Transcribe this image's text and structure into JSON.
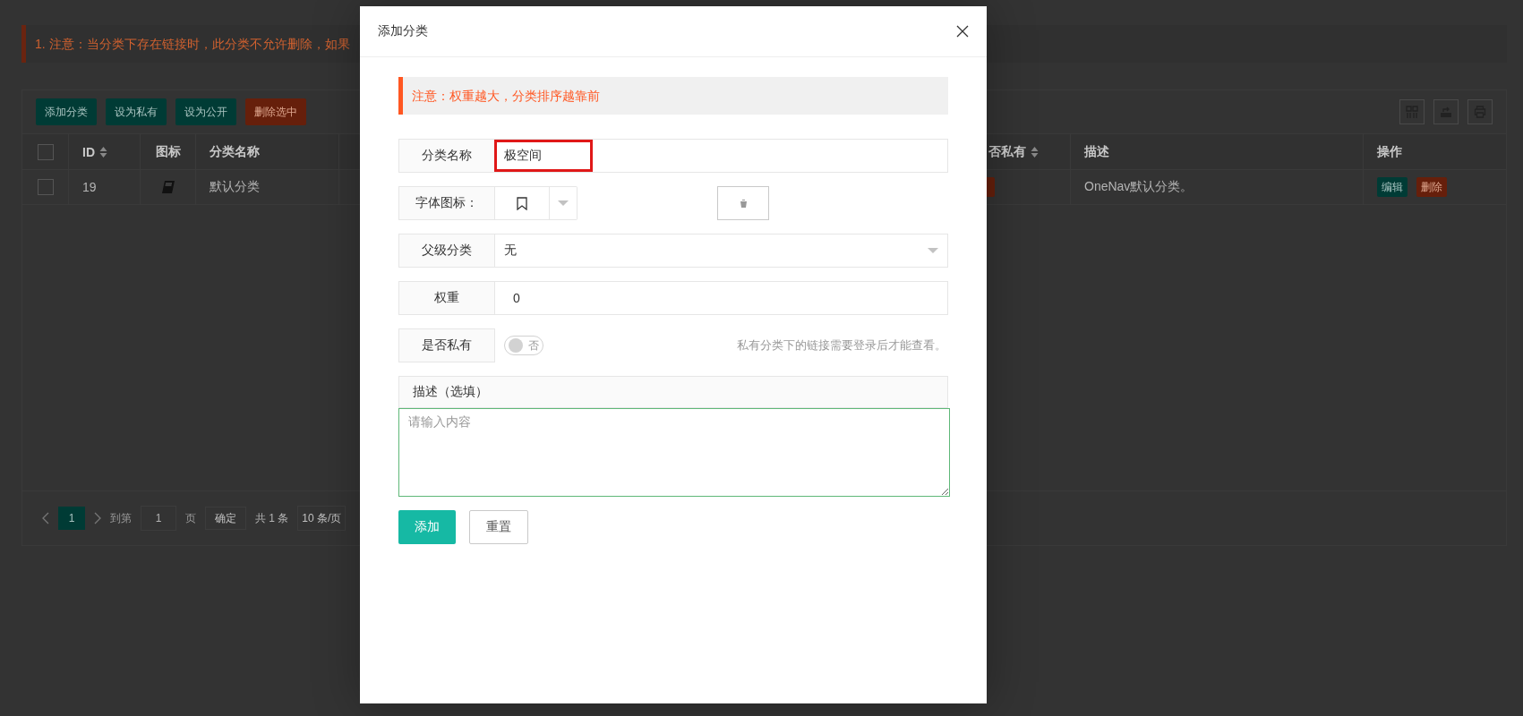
{
  "page": {
    "notice": "1. 注意：当分类下存在链接时，此分类不允许删除，如果",
    "toolbar_buttons": [
      {
        "label": "添加分类",
        "kind": "primary"
      },
      {
        "label": "设为私有",
        "kind": "primary"
      },
      {
        "label": "设为公开",
        "kind": "primary"
      },
      {
        "label": "删除选中",
        "kind": "danger"
      }
    ],
    "table": {
      "header_checked": false,
      "columns": [
        {
          "label": "ID",
          "sortable": true
        },
        {
          "label": "图标",
          "sortable": false
        },
        {
          "label": "分类名称",
          "sortable": false
        },
        {
          "label": "否私有",
          "sortable": true
        },
        {
          "label": "描述",
          "sortable": false
        },
        {
          "label": "操作",
          "sortable": false
        }
      ],
      "rows": [
        {
          "checked": false,
          "id": "19",
          "name": "默认分类",
          "description": "OneNav默认分类。",
          "actions": [
            {
              "label": "编辑",
              "kind": "primary"
            },
            {
              "label": "删除",
              "kind": "danger"
            }
          ]
        }
      ]
    },
    "pagination": {
      "pages": [
        {
          "label": "1",
          "selected": true
        }
      ],
      "goto_label": "到第",
      "goto_value": "1",
      "page_unit": "页",
      "confirm": "确定",
      "total": "共 1 条",
      "page_size": "10 条/页"
    }
  },
  "dialog": {
    "title": "添加分类",
    "notice": "注意：权重越大，分类排序越靠前",
    "fields": [
      {
        "kind": "text",
        "label": "分类名称",
        "value": "极空间",
        "highlighted": true
      },
      {
        "kind": "icon_picker",
        "label": "字体图标："
      },
      {
        "kind": "select",
        "label": "父级分类",
        "value": "无"
      },
      {
        "kind": "text",
        "label": "权重",
        "value": "0"
      },
      {
        "kind": "switch",
        "label": "是否私有",
        "on": false,
        "switch_text": "否",
        "hint": "私有分类下的链接需要登录后才能查看。"
      }
    ],
    "description": {
      "label": "描述（选填）",
      "placeholder": "请输入内容"
    },
    "buttons": [
      {
        "label": "添加",
        "kind": "primary"
      },
      {
        "label": "重置",
        "kind": "default"
      }
    ]
  }
}
